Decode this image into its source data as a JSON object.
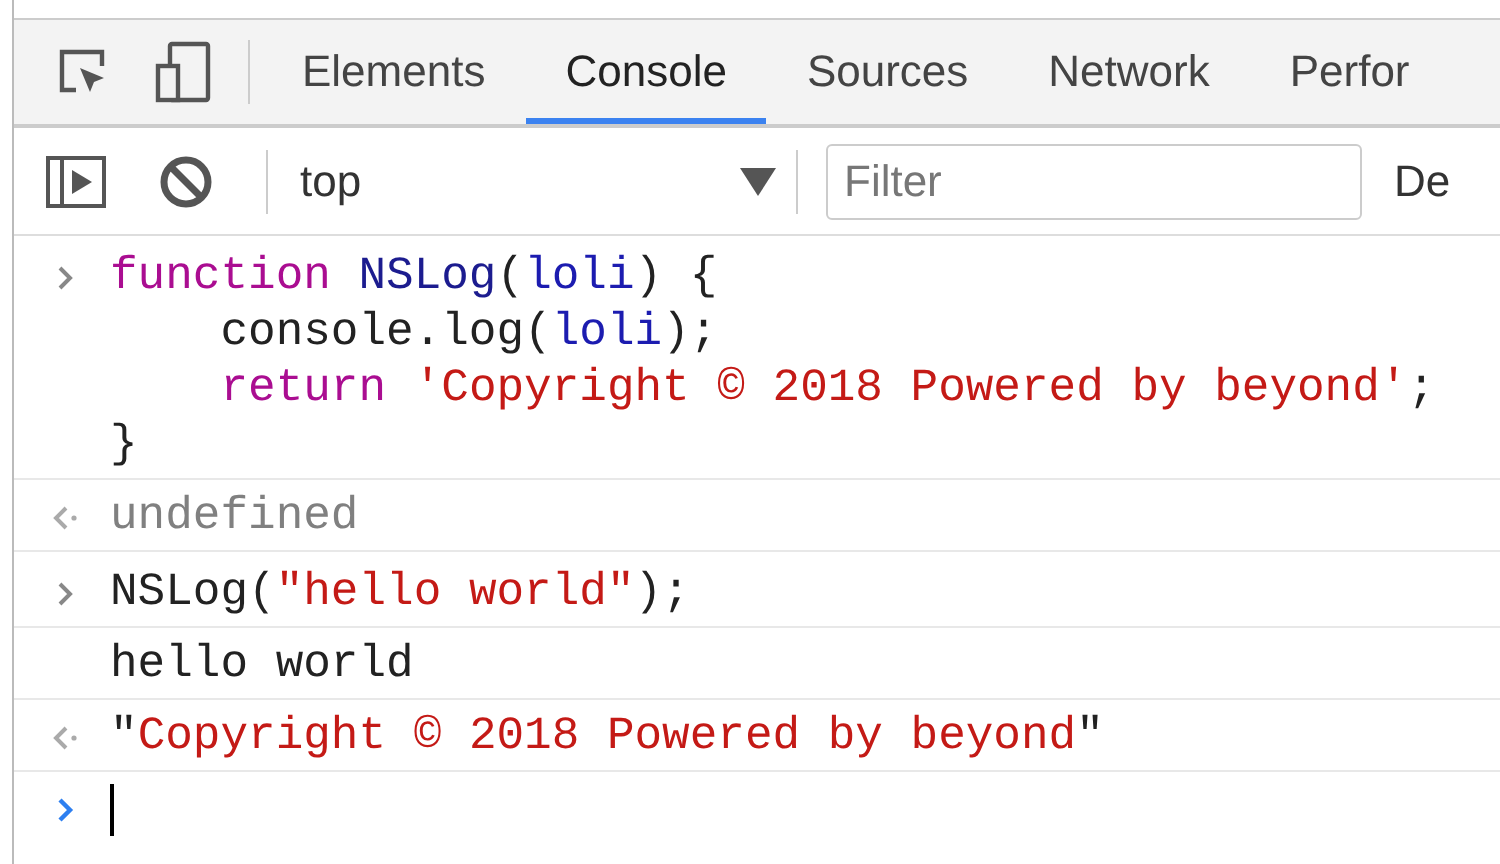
{
  "tabs": [
    {
      "label": "Elements",
      "selected": false
    },
    {
      "label": "Console",
      "selected": true
    },
    {
      "label": "Sources",
      "selected": false
    },
    {
      "label": "Network",
      "selected": false
    },
    {
      "label": "Perfor",
      "selected": false
    }
  ],
  "console_toolbar": {
    "context": "top",
    "filter": {
      "placeholder": "Filter"
    },
    "levels": "De"
  },
  "entries": [
    {
      "kind": "input",
      "lines": [
        [
          {
            "text": "function",
            "kind": "keyword"
          },
          {
            "text": " NSLog",
            "kind": "name"
          },
          {
            "text": "(",
            "kind": "plain"
          },
          {
            "text": "loli",
            "kind": "variable"
          },
          {
            "text": ") {",
            "kind": "plain"
          }
        ],
        [
          {
            "text": "    console.log(",
            "kind": "plain"
          },
          {
            "text": "loli",
            "kind": "variable"
          },
          {
            "text": ");",
            "kind": "plain"
          }
        ],
        [
          {
            "text": "    return",
            "kind": "keyword"
          },
          {
            "text": " 'Copyright © 2018 Powered by beyond'",
            "kind": "string"
          },
          {
            "text": ";",
            "kind": "plain"
          }
        ],
        [
          {
            "text": "}",
            "kind": "plain"
          }
        ]
      ]
    },
    {
      "kind": "result",
      "lines": [
        [
          {
            "text": "undefined",
            "kind": "undefined"
          }
        ]
      ]
    },
    {
      "kind": "input",
      "lines": [
        [
          {
            "text": "NSLog(",
            "kind": "plain"
          },
          {
            "text": "\"hello world\"",
            "kind": "string"
          },
          {
            "text": ");",
            "kind": "plain"
          }
        ]
      ]
    },
    {
      "kind": "log",
      "lines": [
        [
          {
            "text": "hello world",
            "kind": "plain"
          }
        ]
      ]
    },
    {
      "kind": "result",
      "lines": [
        [
          {
            "text": "\"",
            "kind": "plain"
          },
          {
            "text": "Copyright © 2018 Powered by beyond",
            "kind": "string"
          },
          {
            "text": "\"",
            "kind": "plain"
          }
        ]
      ]
    }
  ]
}
